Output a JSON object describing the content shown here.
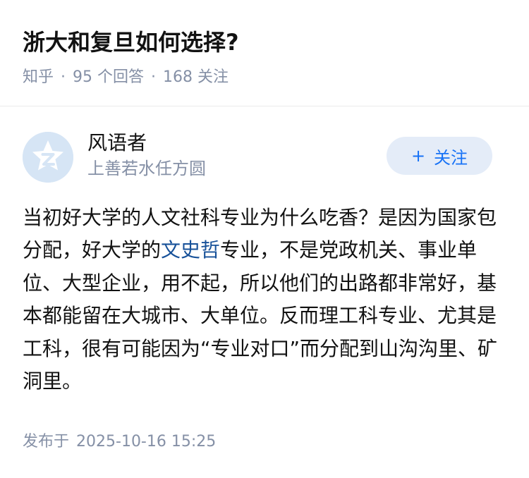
{
  "question": {
    "title": "浙大和复旦如何选择?",
    "source": "知乎",
    "answer_count": "95",
    "answer_count_suffix": "个回答",
    "follower_count": "168",
    "follower_count_suffix": "关注",
    "separator": "·"
  },
  "author": {
    "avatar_icon": "zhihu-default-avatar-icon",
    "name": "风语者",
    "bio": "上善若水任方圆"
  },
  "follow_button": {
    "plus": "+",
    "label": "关注"
  },
  "answer": {
    "text_before_link": "当初好大学的人文社科专业为什么吃香？是因为国家包分配，好大学的",
    "link_text": "文史哲",
    "text_after_link": "专业，不是党政机关、事业单位、大型企业，用不起，所以他们的出路都非常好，基本都能留在大城市、大单位。反而理工科专业、尤其是工科，很有可能因为“专业对口”而分配到山沟沟里、矿洞里。"
  },
  "publish": {
    "label": "发布于",
    "datetime": "2025-10-16 15:25"
  },
  "colors": {
    "meta_gray": "#8590a6",
    "link_blue": "#175199",
    "follow_blue": "#1772f6",
    "follow_bg": "#e4ecf8",
    "avatar_bg": "#d6e5f5"
  }
}
